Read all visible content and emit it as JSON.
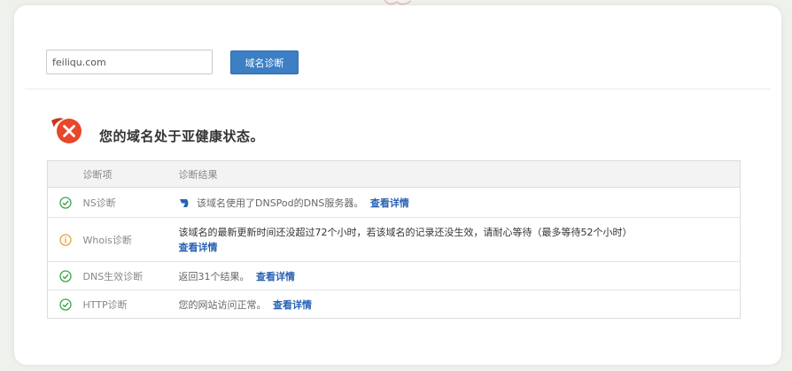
{
  "search": {
    "value": "feiliqu.com",
    "button_label": "域名诊断"
  },
  "status": {
    "message": "您的域名处于亚健康状态。"
  },
  "table": {
    "headers": [
      "诊断项",
      "诊断结果"
    ],
    "rows": [
      {
        "item": "NS诊断",
        "status": "ok",
        "result": "该域名使用了DNSPod的DNS服务器。",
        "link": "查看详情"
      },
      {
        "item": "Whois诊断",
        "status": "warning",
        "result": "该域名的最新更新时间还没超过72个小时，若该域名的记录还没生效，请耐心等待（最多等待52个小时）",
        "link": "查看详情"
      },
      {
        "item": "DNS生效诊断",
        "status": "ok",
        "result": "返回31个结果。",
        "link": "查看详情"
      },
      {
        "item": "HTTP诊断",
        "status": "ok",
        "result": "您的网站访问正常。",
        "link": "查看详情"
      }
    ]
  },
  "colors": {
    "error": "#e8472b",
    "ok": "#3aa64a",
    "warning": "#e6a23c",
    "link": "#2a62b3",
    "button": "#3d7fc4"
  }
}
